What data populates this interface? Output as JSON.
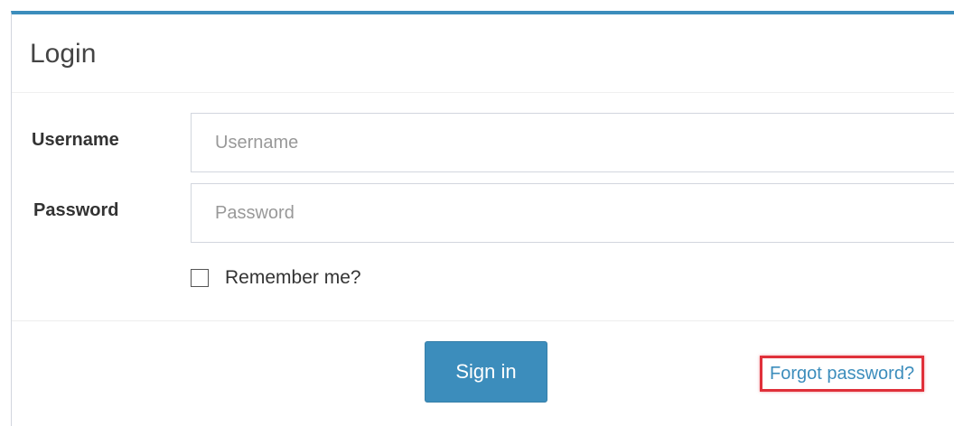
{
  "panel": {
    "title": "Login"
  },
  "form": {
    "username_label": "Username",
    "username_placeholder": "Username",
    "username_value": "",
    "password_label": "Password",
    "password_placeholder": "Password",
    "password_value": "",
    "remember_label": "Remember me?",
    "remember_checked": false
  },
  "footer": {
    "signin_label": "Sign in",
    "forgot_label": "Forgot password?"
  },
  "colors": {
    "accent": "#3c8dbc",
    "highlight": "#e0303a"
  }
}
